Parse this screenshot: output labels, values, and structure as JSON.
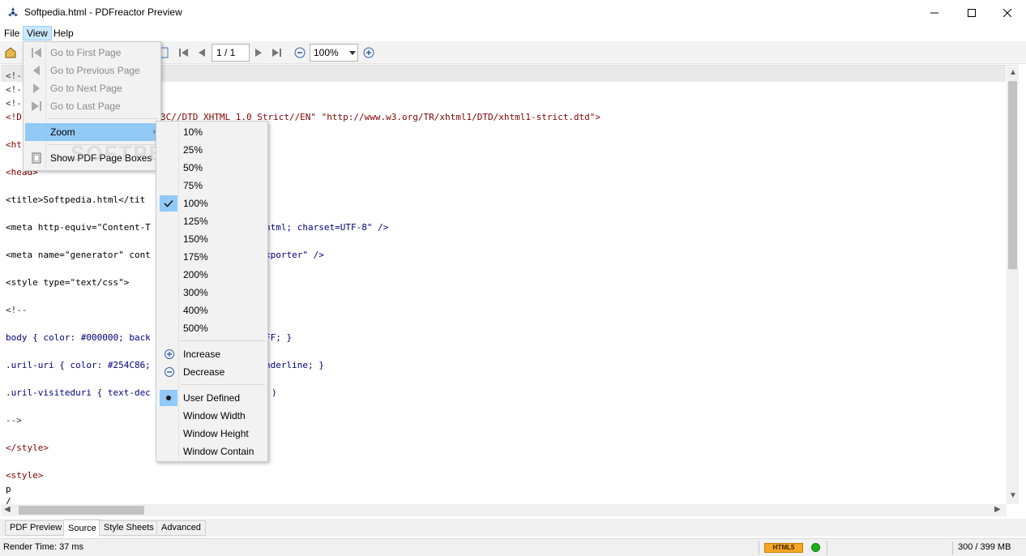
{
  "window": {
    "title": "Softpedia.html - PDFreactor Preview"
  },
  "menubar": {
    "file": "File",
    "view": "View",
    "help": "Help"
  },
  "toolbar": {
    "page_value": "1 / 1",
    "zoom_value": "100%"
  },
  "view_menu": {
    "items": [
      {
        "label": "Go to First Page",
        "enabled": false,
        "icon": "first-page-icon"
      },
      {
        "label": "Go to Previous Page",
        "enabled": false,
        "icon": "previous-page-icon"
      },
      {
        "label": "Go to Next Page",
        "enabled": false,
        "icon": "next-page-icon"
      },
      {
        "label": "Go to Last Page",
        "enabled": false,
        "icon": "last-page-icon"
      },
      {
        "label": "Zoom",
        "enabled": true,
        "submenu": true
      },
      {
        "label": "Show PDF Page Boxes",
        "enabled": true,
        "icon": "page-boxes-icon"
      }
    ]
  },
  "zoom_menu": {
    "levels": [
      "10%",
      "25%",
      "50%",
      "75%",
      "100%",
      "125%",
      "150%",
      "175%",
      "200%",
      "300%",
      "400%",
      "500%"
    ],
    "selected_level": "100%",
    "increase": "Increase",
    "decrease": "Decrease",
    "modes": [
      "User Defined",
      "Window Width",
      "Window Height",
      "Window Contain"
    ],
    "selected_mode": "User Defined"
  },
  "source_lines": [
    "<!--",
    "<!--",
    "<!--",
    "<!D",
    "<ht",
    "<head>",
    "<title>Softpedia.html</tit",
    "<meta http-equiv=\"Content-T",
    "<meta name=\"generator\" cont",
    "<style type=\"text/css\">",
    "<!--",
    "body { color: #000000; back",
    ".uril-uri { color: #254C86;",
    ".uril-visiteduri { text-dec",
    "-->",
    "</style>",
    "<style>",
    "p",
    "/"
  ],
  "source_fragments": {
    "doctype_tail": "3C//DTD XHTML 1.0 Strict//EN\" \"http://www.w3.org/TR/xhtml1/DTD/xhtml1-strict.dtd\">",
    "meta1_tail": "html; charset=UTF-8\" />",
    "meta2_tail": "xporter\" />",
    "body_tail": "FF; }",
    "uri_tail": "nderline; }",
    "visited_tail": ")"
  },
  "tabs": [
    "PDF Preview",
    "Source",
    "Style Sheets",
    "Advanced"
  ],
  "active_tab": "Source",
  "status": {
    "render_time": "Render Time: 37 ms",
    "html5_badge": "HTML5",
    "memory": "300 / 399 MB"
  },
  "watermark": "SOFTPEDIA"
}
